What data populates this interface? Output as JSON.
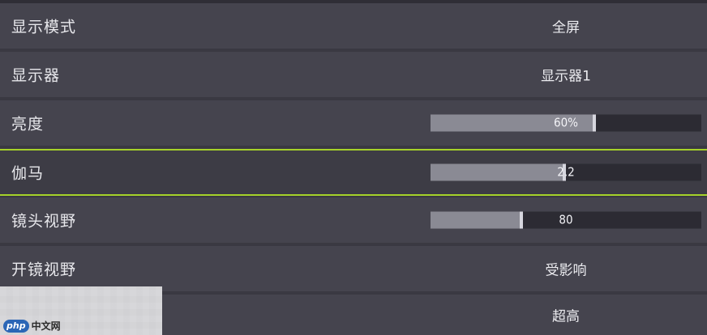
{
  "settings": [
    {
      "label": "显示模式",
      "value": "全屏"
    },
    {
      "label": "显示器",
      "value": "显示器1"
    },
    {
      "label": "亮度",
      "value": "60%",
      "slider_fraction": 0.61
    },
    {
      "label": "伽马",
      "value": "2.2",
      "slider_fraction": 0.5
    },
    {
      "label": "镜头视野",
      "value": "80",
      "slider_fraction": 0.34
    },
    {
      "label": "开镜视野",
      "value": "受影响"
    },
    {
      "label": "",
      "value": "超高"
    }
  ],
  "watermark": {
    "badge": "php",
    "text": "中文网"
  },
  "colors": {
    "row_bg": "#45444e",
    "page_bg": "#3a3942",
    "selection_border": "#a6d22a",
    "slider_fill": "#8a8a94",
    "slider_track": "#2c2b33"
  }
}
